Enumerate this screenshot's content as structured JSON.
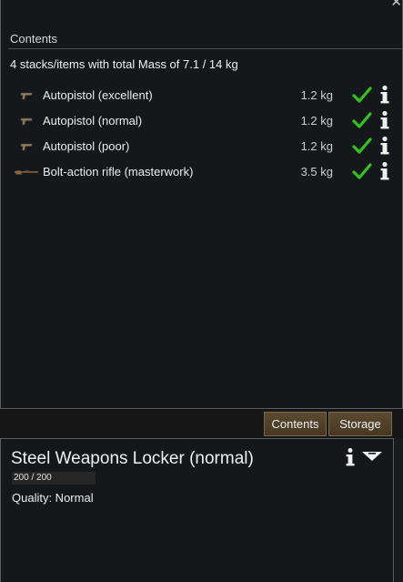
{
  "contents_panel": {
    "close_glyph": "✕",
    "section_title": "Contents",
    "summary": "4 stacks/items with total Mass of 7.1 / 14 kg",
    "items": [
      {
        "icon": "pistol-icon",
        "label": "Autopistol (excellent)",
        "mass": "1.2 kg",
        "allowed": true
      },
      {
        "icon": "pistol-icon",
        "label": "Autopistol (normal)",
        "mass": "1.2 kg",
        "allowed": true
      },
      {
        "icon": "pistol-icon",
        "label": "Autopistol (poor)",
        "mass": "1.2 kg",
        "allowed": true
      },
      {
        "icon": "rifle-icon",
        "label": "Bolt-action rifle (masterwork)",
        "mass": "3.5 kg",
        "allowed": true
      }
    ]
  },
  "tabs": [
    {
      "label": "Contents"
    },
    {
      "label": "Storage"
    }
  ],
  "inspect": {
    "title": "Steel Weapons Locker (normal)",
    "hit_points": "200 / 200",
    "hit_points_fraction": 1.0,
    "quality": "Quality: Normal"
  },
  "colors": {
    "check": "#33c21e",
    "tab_bg": "#5b4a30",
    "panel_bg": "#15181a"
  }
}
